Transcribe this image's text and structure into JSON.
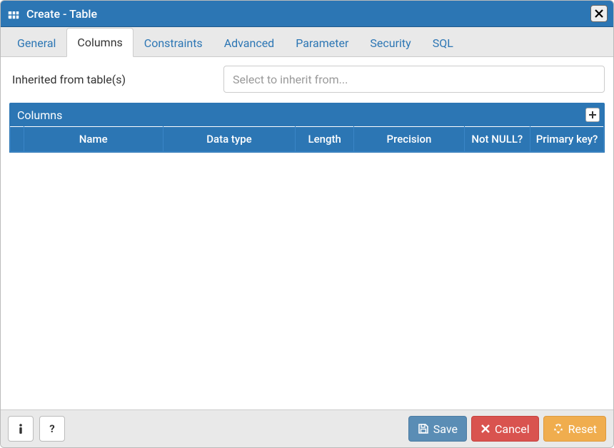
{
  "title": "Create - Table",
  "tabs": {
    "general": {
      "label": "General"
    },
    "columns": {
      "label": "Columns"
    },
    "constraints": {
      "label": "Constraints"
    },
    "advanced": {
      "label": "Advanced"
    },
    "parameter": {
      "label": "Parameter"
    },
    "security": {
      "label": "Security"
    },
    "sql": {
      "label": "SQL"
    }
  },
  "inherit": {
    "label": "Inherited from table(s)",
    "placeholder": "Select to inherit from..."
  },
  "columns_panel": {
    "title": "Columns",
    "headers": {
      "name": "Name",
      "datatype": "Data type",
      "length": "Length",
      "precision": "Precision",
      "notnull": "Not NULL?",
      "pk": "Primary key?"
    },
    "rows": []
  },
  "footer": {
    "save": "Save",
    "cancel": "Cancel",
    "reset": "Reset"
  }
}
